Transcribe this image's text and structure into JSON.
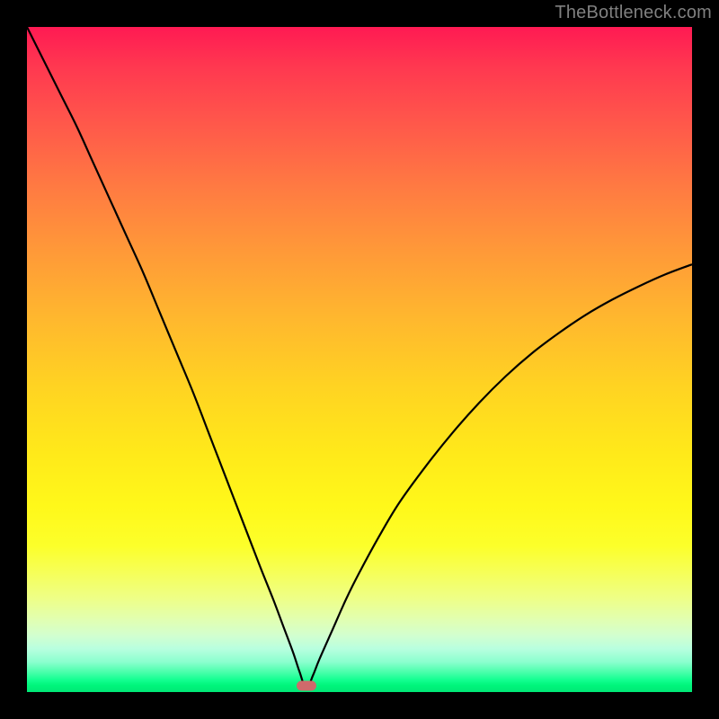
{
  "watermark": "TheBottleneck.com",
  "colors": {
    "frame": "#000000",
    "curve": "#000000",
    "marker": "#cf6a6b",
    "watermark": "#808080"
  },
  "chart_data": {
    "type": "line",
    "title": "",
    "xlabel": "",
    "ylabel": "",
    "xlim": [
      0,
      100
    ],
    "ylim": [
      0,
      100
    ],
    "grid": false,
    "legend": false,
    "description": "V-shaped bottleneck curve over a green-to-red vertical gradient. Minimum (optimal point) marked by a small red pill near the bottom.",
    "min_point_x": 42,
    "marker_y": 99,
    "series": [
      {
        "name": "bottleneck-curve",
        "x": [
          0,
          2.5,
          5,
          7.5,
          10,
          12.5,
          15,
          17.5,
          20,
          22.5,
          25,
          27.5,
          30,
          32.5,
          35,
          37,
          38.5,
          40,
          41,
          42,
          43,
          44,
          46,
          48,
          50,
          53,
          56,
          60,
          64,
          68,
          72,
          76,
          80,
          84,
          88,
          92,
          96,
          100
        ],
        "y": [
          100,
          95,
          90,
          85,
          79.5,
          74,
          68.5,
          63,
          57,
          51,
          45,
          38.5,
          32,
          25.5,
          19,
          14,
          10,
          6,
          3,
          0.5,
          2.5,
          5,
          9.5,
          14,
          18,
          23.5,
          28.5,
          34,
          39,
          43.5,
          47.5,
          51,
          54,
          56.7,
          59,
          61,
          62.8,
          64.3
        ]
      }
    ]
  }
}
